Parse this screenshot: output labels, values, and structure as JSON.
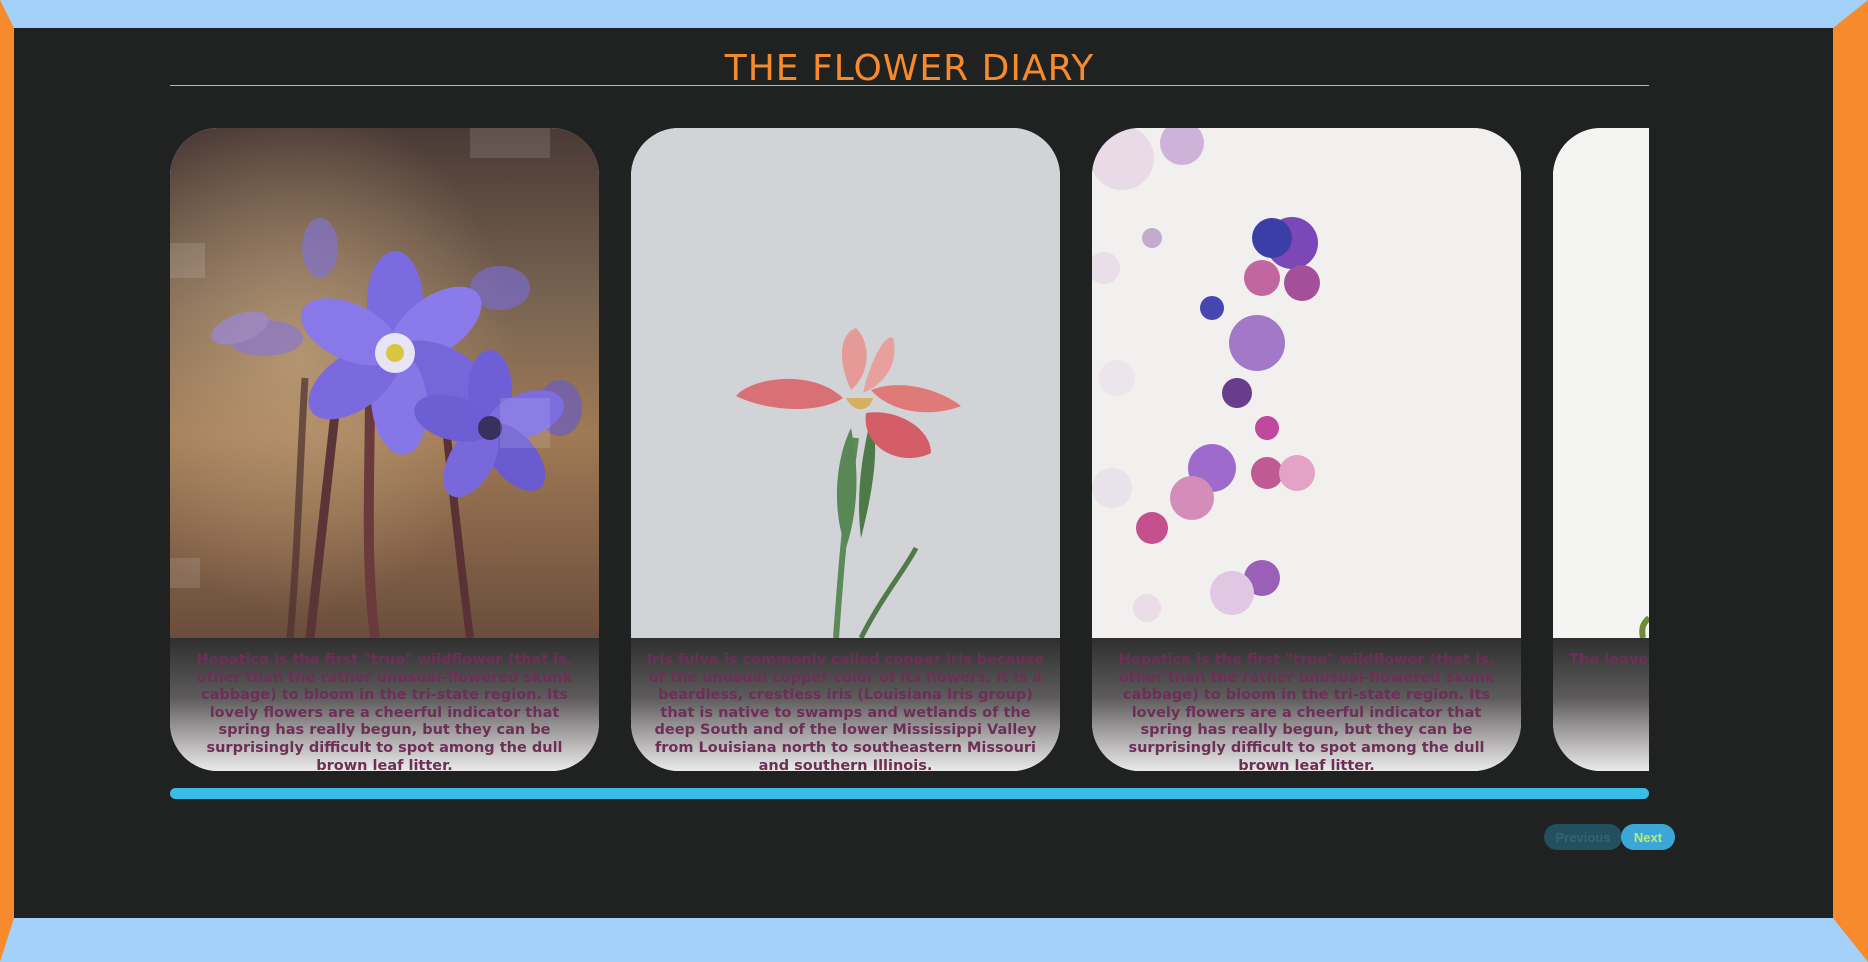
{
  "page": {
    "title": "THE FLOWER DIARY"
  },
  "cards": [
    {
      "caption": "Hepatica is the first \"true\" wildflower (that is, other than the rather unusual-flowered skunk cabbage) to bloom in the tri-state region. Its lovely flowers are a cheerful indicator that spring has really begun, but they can be surprisingly difficult to spot among the dull brown leaf litter.",
      "image": "purple hepatica flowers on blurred brown background with Unsplash+ watermark"
    },
    {
      "caption": "Iris fulva is commonly called copper iris because of the unusual copper color of its flowers. It is a beardless, crestless iris (Louisiana Iris group) that is native to swamps and wetlands of the deep South and of the lower Mississippi Valley from Louisiana north to southeastern Missouri and southern Illinois.",
      "image": "single pink iris on light grey background"
    },
    {
      "caption": "Hepatica is the first \"true\" wildflower (that is, other than the rather unusual-flowered skunk cabbage) to bloom in the tri-state region. Its lovely flowers are a cheerful indicator that spring has really begun, but they can be surprisingly difficult to spot among the dull brown leaf litter.",
      "image": "scattered purple and pink petals on white background"
    },
    {
      "caption": "The leaves medicin leaves a Eucalypt antioxidan think t",
      "image": "white background with a hint of green leaf"
    }
  ],
  "controls": {
    "previous_label": "Previous",
    "next_label": "Next"
  },
  "colors": {
    "accent": "#f68a2c",
    "panel": "#202221",
    "frame": "#a3d1fa",
    "progress": "#38bde6",
    "caption_text": "#6e2f56"
  }
}
